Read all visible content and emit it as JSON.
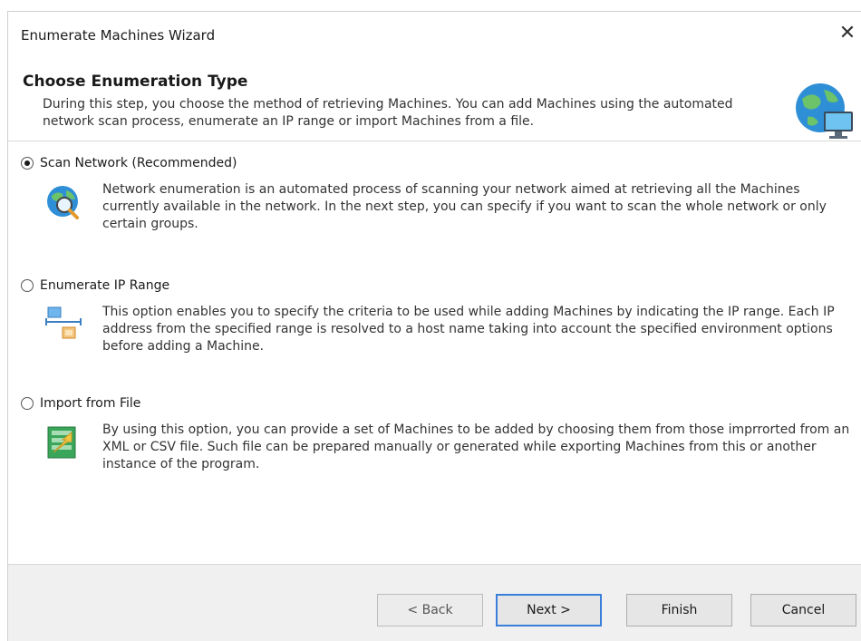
{
  "window": {
    "title": "Enumerate Machines Wizard",
    "close_glyph": "✕"
  },
  "header": {
    "title": "Choose Enumeration Type",
    "description": "During this step, you choose the method of retrieving Machines. You can add Machines using the automated network scan process, enumerate an IP range or import Machines from a file.",
    "icon": "globe-monitor-icon"
  },
  "options": [
    {
      "label": "Scan Network (Recommended)",
      "selected": true,
      "icon": "globe-magnifier-icon",
      "description": "Network enumeration is an automated process of scanning your network aimed at retrieving all the Machines currently available in the network. In the next step, you can specify if you want to scan the whole network or only certain groups."
    },
    {
      "label": "Enumerate IP Range",
      "selected": false,
      "icon": "ip-range-icon",
      "description": "This option enables you to specify the criteria to be used while adding Machines by indicating the IP range. Each IP address from the specified range is resolved to a host name taking into account the specified environment options before adding a Machine."
    },
    {
      "label": "Import from File",
      "selected": false,
      "icon": "import-file-icon",
      "description": "By using this option, you can provide a set of Machines to be added by choosing them from those imprrorted from an XML or CSV file. Such file can be prepared manually or generated while exporting Machines from this or another instance of the program."
    }
  ],
  "buttons": {
    "back": "< Back",
    "next": "Next >",
    "finish": "Finish",
    "cancel": "Cancel"
  }
}
